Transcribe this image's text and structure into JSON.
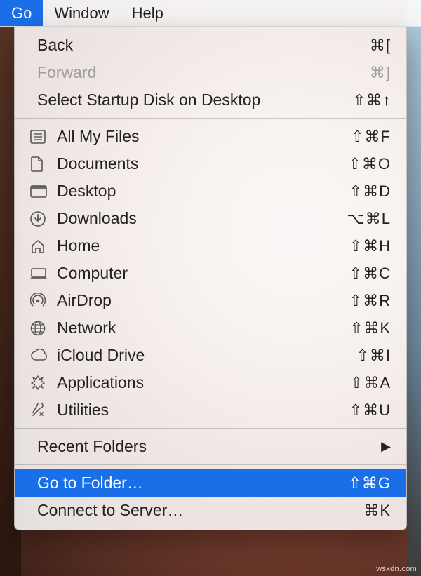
{
  "menubar": {
    "go": "Go",
    "window": "Window",
    "help": "Help"
  },
  "menu": {
    "back": {
      "label": "Back",
      "shortcut": "⌘["
    },
    "forward": {
      "label": "Forward",
      "shortcut": "⌘]"
    },
    "startup": {
      "label": "Select Startup Disk on Desktop",
      "shortcut": "⇧⌘↑"
    },
    "allfiles": {
      "label": "All My Files",
      "shortcut": "⇧⌘F"
    },
    "documents": {
      "label": "Documents",
      "shortcut": "⇧⌘O"
    },
    "desktop": {
      "label": "Desktop",
      "shortcut": "⇧⌘D"
    },
    "downloads": {
      "label": "Downloads",
      "shortcut": "⌥⌘L"
    },
    "home": {
      "label": "Home",
      "shortcut": "⇧⌘H"
    },
    "computer": {
      "label": "Computer",
      "shortcut": "⇧⌘C"
    },
    "airdrop": {
      "label": "AirDrop",
      "shortcut": "⇧⌘R"
    },
    "network": {
      "label": "Network",
      "shortcut": "⇧⌘K"
    },
    "icloud": {
      "label": "iCloud Drive",
      "shortcut": "⇧⌘I"
    },
    "applications": {
      "label": "Applications",
      "shortcut": "⇧⌘A"
    },
    "utilities": {
      "label": "Utilities",
      "shortcut": "⇧⌘U"
    },
    "recent": {
      "label": "Recent Folders"
    },
    "gotofolder": {
      "label": "Go to Folder…",
      "shortcut": "⇧⌘G"
    },
    "connect": {
      "label": "Connect to Server…",
      "shortcut": "⌘K"
    }
  },
  "watermark": "wsxdn.com"
}
